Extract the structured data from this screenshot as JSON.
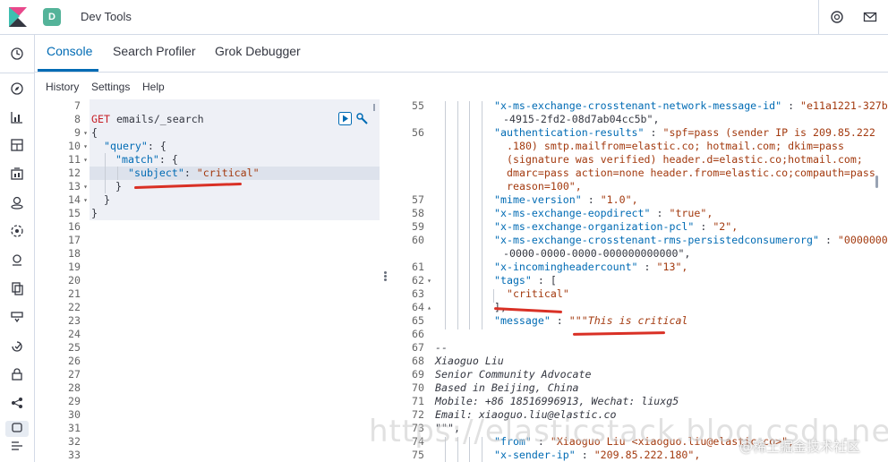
{
  "header": {
    "space_initial": "D",
    "title": "Dev Tools",
    "space_color": "#54b399"
  },
  "tabs": [
    {
      "label": "Console",
      "active": true
    },
    {
      "label": "Search Profiler",
      "active": false
    },
    {
      "label": "Grok Debugger",
      "active": false
    }
  ],
  "subnav": {
    "history": "History",
    "settings": "Settings",
    "help": "Help"
  },
  "request_editor": {
    "line_numbers": [
      "7",
      "8",
      "9",
      "10",
      "11",
      "12",
      "13",
      "14",
      "15",
      "16",
      "17",
      "18",
      "19",
      "20",
      "21",
      "22",
      "23",
      "24",
      "25",
      "26",
      "27",
      "28",
      "29",
      "30",
      "31",
      "32",
      "33"
    ],
    "method": "GET",
    "path": "emails/_search",
    "open_brace": "{",
    "query_key": "\"query\"",
    "match_key": "\"match\"",
    "subject_key": "\"subject\"",
    "subject_value": "\"critical\"",
    "close_brace": "}",
    "colon_brace": ": {",
    "colon": ": "
  },
  "response_editor": {
    "line_numbers": [
      "55",
      "",
      "56",
      "",
      "",
      "",
      "",
      "57",
      "58",
      "59",
      "60",
      "",
      "61",
      "62",
      "63",
      "64",
      "65",
      "66",
      "67",
      "68",
      "69",
      "70",
      "71",
      "72",
      "73",
      "74",
      "75"
    ],
    "lines": [
      "\"x-ms-exchange-crosstenant-network-message-id\" : \"e11a1221-327b",
      "-4915-2fd2-08d7ab04cc5b\",",
      "\"authentication-results\" : \"spf=pass (sender IP is 209.85.222",
      ".180) smtp.mailfrom=elastic.co; hotmail.com; dkim=pass",
      "(signature was verified) header.d=elastic.co;hotmail.com;",
      "dmarc=pass action=none header.from=elastic.co;compauth=pass",
      "reason=100\",",
      "\"mime-version\" : \"1.0\",",
      "\"x-ms-exchange-eopdirect\" : \"true\",",
      "\"x-ms-exchange-organization-pcl\" : \"2\",",
      "\"x-ms-exchange-crosstenant-rms-persistedconsumerorg\" : \"00000000",
      "-0000-0000-0000-000000000000\",",
      "\"x-incomingheadercount\" : \"13\",",
      "\"tags\" : [",
      "\"critical\"",
      "],",
      "\"message\" : \"\"\"This is critical",
      "",
      "--",
      "Xiaoguo Liu",
      "Senior Community Advocate",
      "Based in Beijing, China",
      "Mobile: +86 18516996913, Wechat: liuxg5",
      "Email: xiaoguo.liu@elastic.co",
      "\"\"\",",
      "\"from\" : \"Xiaoguo Liu <xiaoguo.liu@elastic.co>\",",
      "\"x-sender-ip\" : \"209.85.222.180\","
    ]
  },
  "watermark": {
    "text": "https://elasticstack.blog.csdn.net",
    "credit": "@稀土掘金技术社区"
  },
  "colors": {
    "accent": "#006bb4",
    "annotation": "#d93025"
  }
}
